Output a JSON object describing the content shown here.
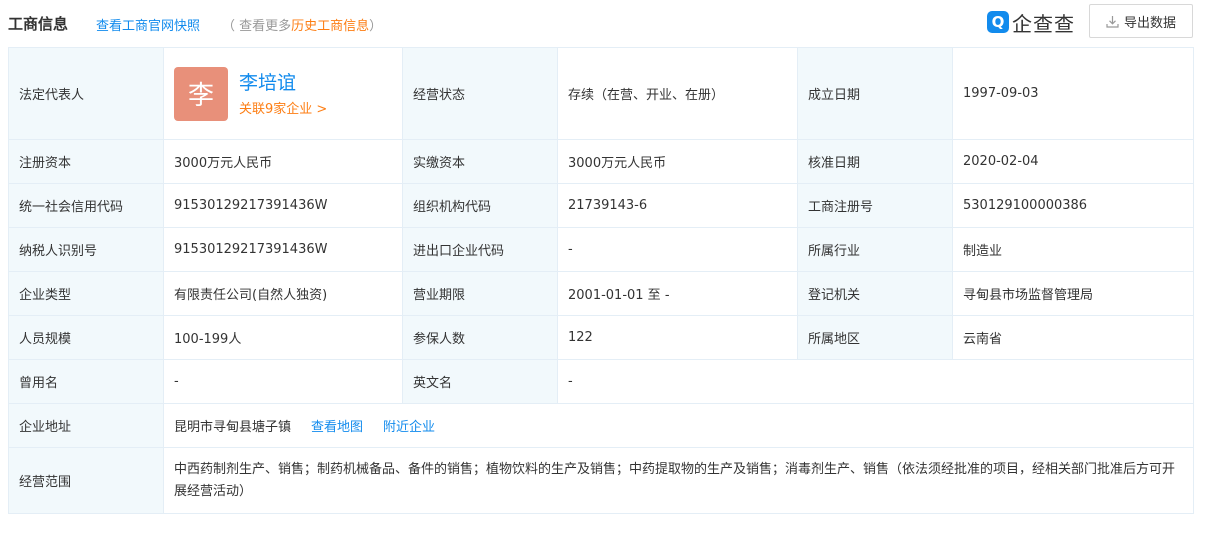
{
  "header": {
    "title": "工商信息",
    "snapshot_link": "查看工商官网快照",
    "more_prefix": "（ 查看更多",
    "more_link": "历史工商信息",
    "more_suffix": "）",
    "logo_mark": "Q",
    "logo_text": "企查查",
    "export_label": "导出数据"
  },
  "colors": {
    "link": "#128bed",
    "orange": "#fd7e14",
    "label_bg": "#f2f9fc",
    "border": "#e4eef6",
    "avatar": "#e8907a"
  },
  "legal_rep": {
    "label": "法定代表人",
    "avatar_char": "李",
    "name": "李培谊",
    "related": "关联9家企业 >"
  },
  "rows": {
    "status_label": "经营状态",
    "status_value": "存续（在营、开业、在册）",
    "est_label": "成立日期",
    "est_value": "1997-09-03",
    "reg_cap_label": "注册资本",
    "reg_cap_value": "3000万元人民币",
    "paid_cap_label": "实缴资本",
    "paid_cap_value": "3000万元人民币",
    "approve_label": "核准日期",
    "approve_value": "2020-02-04",
    "credit_label": "统一社会信用代码",
    "credit_value": "91530129217391436W",
    "org_label": "组织机构代码",
    "org_value": "21739143-6",
    "regno_label": "工商注册号",
    "regno_value": "530129100000386",
    "tax_label": "纳税人识别号",
    "tax_value": "91530129217391436W",
    "ie_label": "进出口企业代码",
    "ie_value": "-",
    "industry_label": "所属行业",
    "industry_value": "制造业",
    "type_label": "企业类型",
    "type_value": "有限责任公司(自然人独资)",
    "term_label": "营业期限",
    "term_value": "2001-01-01 至 -",
    "authority_label": "登记机关",
    "authority_value": "寻甸县市场监督管理局",
    "staff_label": "人员规模",
    "staff_value": "100-199人",
    "insured_label": "参保人数",
    "insured_value": "122",
    "region_label": "所属地区",
    "region_value": "云南省",
    "former_label": "曾用名",
    "former_value": "-",
    "en_label": "英文名",
    "en_value": "-",
    "addr_label": "企业地址",
    "addr_value": "昆明市寻甸县塘子镇",
    "addr_map_link": "查看地图",
    "addr_nearby_link": "附近企业",
    "scope_label": "经营范围",
    "scope_value": "中西药制剂生产、销售；制药机械备品、备件的销售；植物饮料的生产及销售；中药提取物的生产及销售；消毒剂生产、销售（依法须经批准的项目，经相关部门批准后方可开展经营活动）"
  }
}
